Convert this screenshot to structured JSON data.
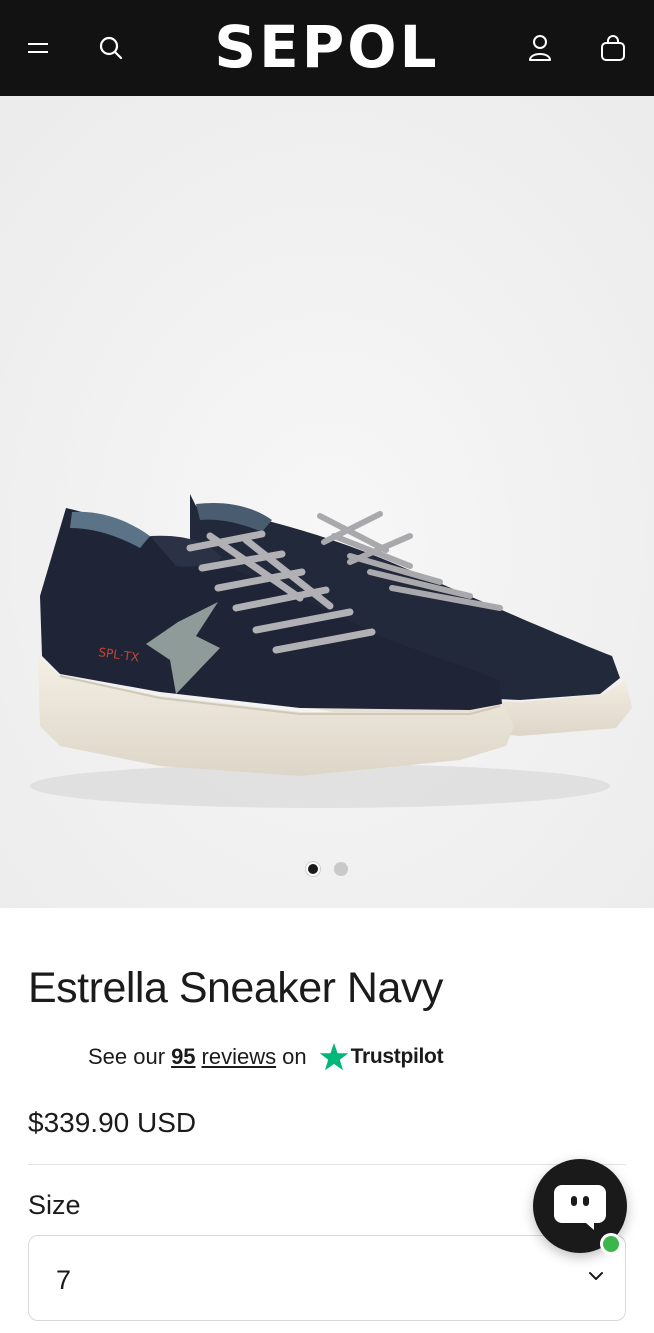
{
  "header": {
    "logo": "SEPOL",
    "icons": [
      "menu-icon",
      "search-icon",
      "account-icon",
      "cart-icon"
    ]
  },
  "gallery": {
    "image_count": 2,
    "active_index": 1
  },
  "product": {
    "title": "Estrella Sneaker Navy",
    "reviews_prefix": "See our",
    "reviews_count": "95",
    "reviews_word": "reviews",
    "reviews_suffix": "on",
    "reviews_brand": "Trustpilot",
    "price": "$339.90 USD"
  },
  "size": {
    "label": "Size",
    "selected": "7"
  },
  "colors": {
    "header_bg": "#121212",
    "trustpilot_green": "#00b67a",
    "online_status": "#3cb54a"
  }
}
